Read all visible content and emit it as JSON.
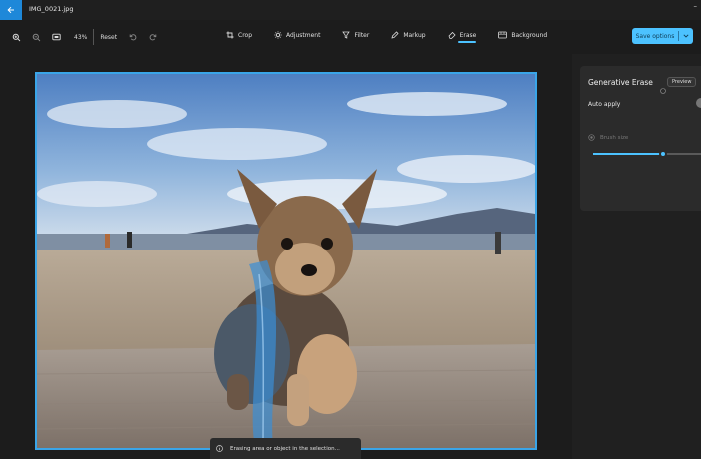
{
  "window": {
    "file_name": "IMG_0021.jpg",
    "minimize_glyph": "–"
  },
  "toolbar": {
    "zoom_percent": "43%",
    "reset_label": "Reset",
    "tabs": [
      {
        "label": "Crop",
        "icon": "crop-icon"
      },
      {
        "label": "Adjustment",
        "icon": "brightness-icon"
      },
      {
        "label": "Filter",
        "icon": "filter-icon"
      },
      {
        "label": "Markup",
        "icon": "pen-icon"
      },
      {
        "label": "Erase",
        "icon": "eraser-icon",
        "active": true
      },
      {
        "label": "Background",
        "icon": "background-icon"
      }
    ],
    "save_label": "Save options",
    "accent": "#4cc2ff"
  },
  "status": {
    "text": "Erasing area or object in the selection..."
  },
  "panel": {
    "title": "Generative Erase",
    "preview_label": "Preview",
    "auto_apply_label": "Auto apply",
    "brush_size_label": "Brush size",
    "brush_size_fraction": 0.65
  }
}
